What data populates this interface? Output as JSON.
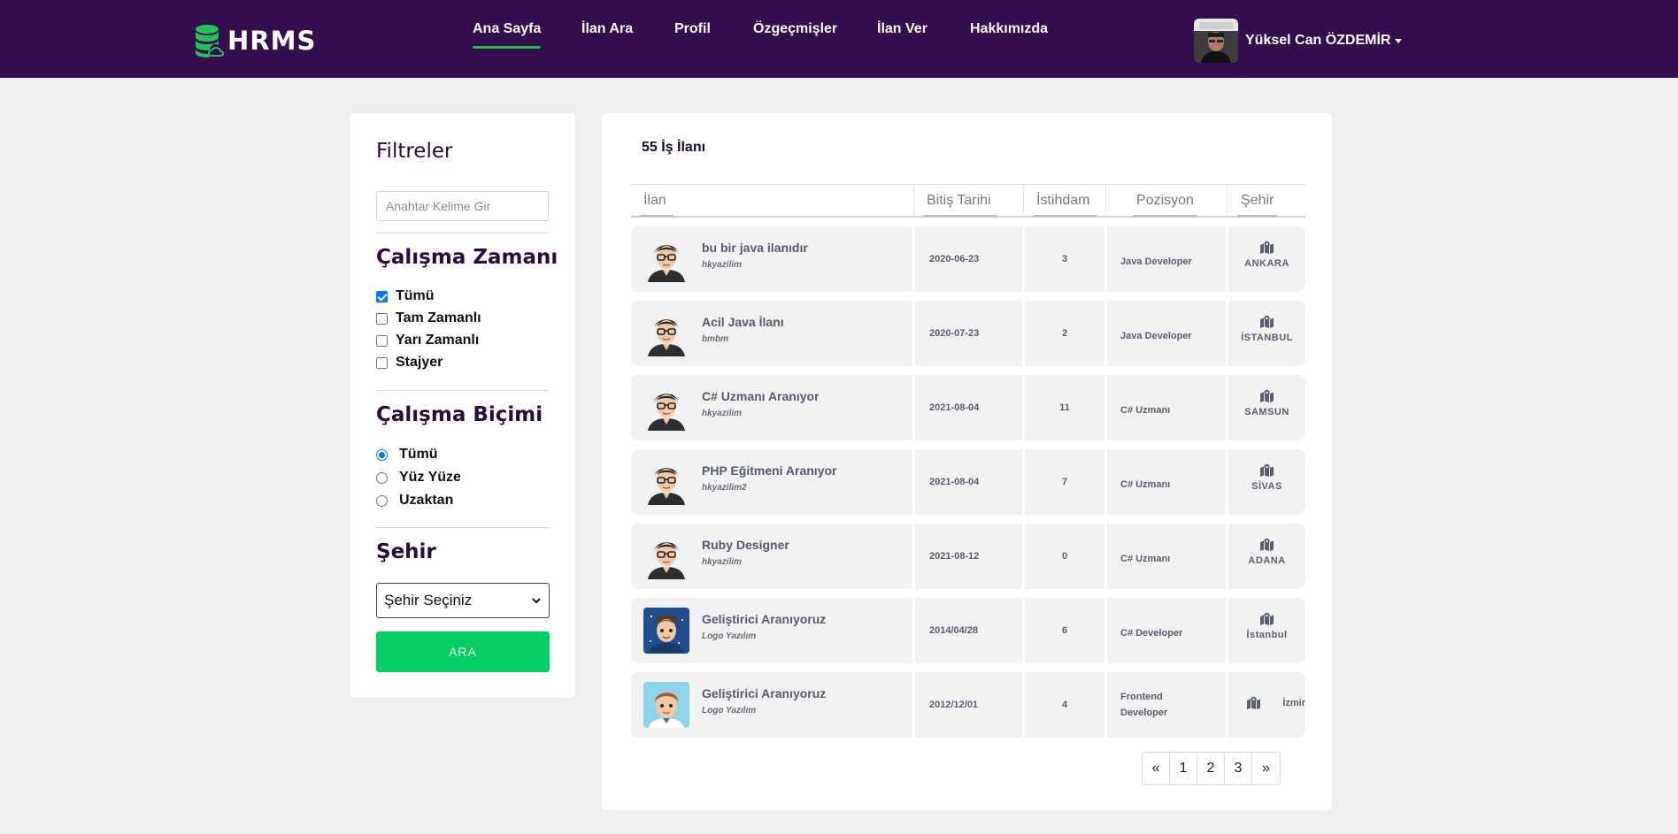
{
  "brand": {
    "name": "HRMS"
  },
  "nav": {
    "items": [
      {
        "label": "Ana Sayfa"
      },
      {
        "label": "İlan Ara"
      },
      {
        "label": "Profil"
      },
      {
        "label": "Özgeçmişler"
      },
      {
        "label": "İlan Ver"
      },
      {
        "label": "Hakkımızda"
      }
    ],
    "active": "Ana Sayfa",
    "user_name": "Yüksel Can ÖZDEMİR"
  },
  "filters": {
    "title": "Filtreler",
    "keyword_placeholder": "Anahtar Kelime Gir",
    "work_time": {
      "title": "Çalışma Zamanı",
      "options": [
        {
          "label": "Tümü",
          "checked": true
        },
        {
          "label": "Tam Zamanlı",
          "checked": false
        },
        {
          "label": "Yarı Zamanlı",
          "checked": false
        },
        {
          "label": "Stajyer",
          "checked": false
        }
      ]
    },
    "work_type": {
      "title": "Çalışma Biçimi",
      "options": [
        {
          "label": "Tümü",
          "selected": true
        },
        {
          "label": "Yüz Yüze",
          "selected": false
        },
        {
          "label": "Uzaktan",
          "selected": false
        }
      ]
    },
    "city": {
      "title": "Şehir",
      "selected": "Şehir Seçiniz"
    },
    "search_button": "ARA"
  },
  "listing": {
    "count_label": "55 İş İlanı",
    "columns": [
      "İlan",
      "Bitiş Tarihi",
      "İstihdam",
      "Pozisyon",
      "Şehir"
    ],
    "rows": [
      {
        "title": "bu bir java ilanıdır",
        "company": "hkyazilim",
        "date": "2020-06-23",
        "count": "3",
        "position": "Java Developer",
        "city": "ANKARA",
        "avatar": "cartoon"
      },
      {
        "title": "Acil Java İlanı",
        "company": "bmbm",
        "date": "2020-07-23",
        "count": "2",
        "position": "Java Developer",
        "city": "İSTANBUL",
        "avatar": "cartoon"
      },
      {
        "title": "C# Uzmanı Aranıyor",
        "company": "hkyazilim",
        "date": "2021-08-04",
        "count": "11",
        "position": "C# Uzmanı",
        "city": "SAMSUN",
        "avatar": "cartoon"
      },
      {
        "title": "PHP Eğitmeni Aranıyor",
        "company": "hkyazilim2",
        "date": "2021-08-04",
        "count": "7",
        "position": "C# Uzmanı",
        "city": "SİVAS",
        "avatar": "cartoon"
      },
      {
        "title": "Ruby Designer",
        "company": "hkyazilim",
        "date": "2021-08-12",
        "count": "0",
        "position": "C# Uzmanı",
        "city": "ADANA",
        "avatar": "cartoon"
      },
      {
        "title": "Geliştirici Aranıyoruz",
        "company": "Logo Yazılım",
        "date": "2014/04/28",
        "count": "6",
        "position": "C# Developer",
        "city": "İstanbul",
        "avatar": "boy-blue"
      },
      {
        "title": "Geliştirici Aranıyoruz",
        "company": "Logo Yazılım",
        "date": "2012/12/01",
        "count": "4",
        "position": "Frontend Developer",
        "city": "İzmir",
        "avatar": "boy-light"
      }
    ]
  },
  "pagination": {
    "items": [
      "«",
      "1",
      "2",
      "3",
      "»"
    ]
  },
  "colors": {
    "navbar": "#340d4f",
    "accent": "#21ba45",
    "button": "#05cf64",
    "title": "#2b0a3d"
  },
  "icons": {
    "brand": "database-cloud-icon",
    "city": "map-marked-icon",
    "caret": "caret-down-icon"
  }
}
